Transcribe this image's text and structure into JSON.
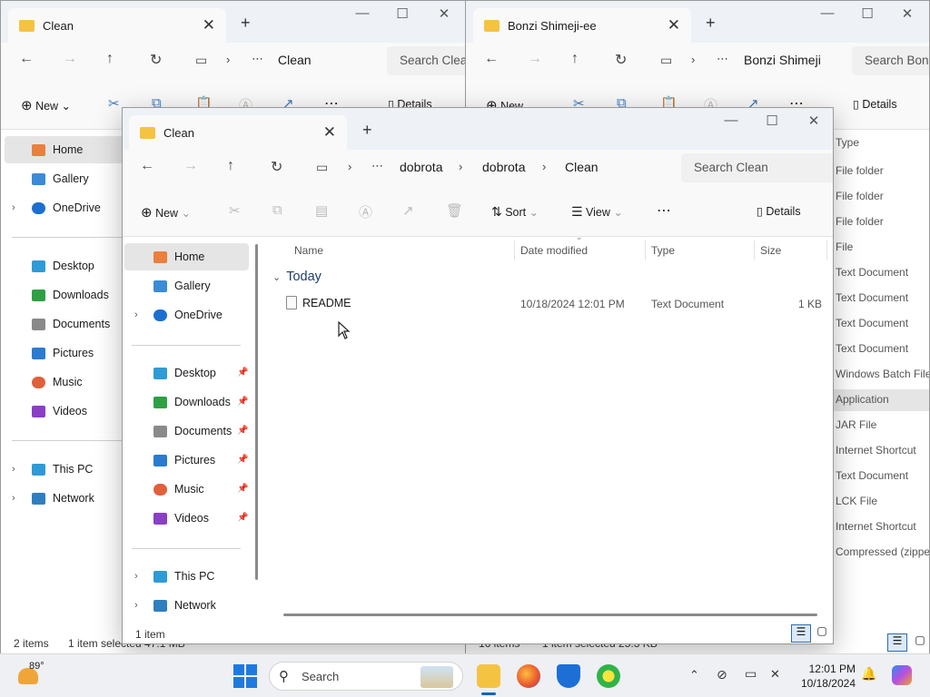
{
  "windows": {
    "left": {
      "tab_title": "Clean",
      "breadcrumb": [
        "Clean"
      ],
      "search_placeholder": "Search Clea",
      "toolbar": {
        "new": "New",
        "details": "Details"
      },
      "sidebar": {
        "home": "Home",
        "gallery": "Gallery",
        "onedrive": "OneDrive",
        "quick": [
          "Desktop",
          "Downloads",
          "Documents",
          "Pictures",
          "Music",
          "Videos"
        ],
        "this_pc": "This PC",
        "network": "Network"
      },
      "status": {
        "items": "2 items",
        "selected": "1 item selected  47.1 MB"
      }
    },
    "right": {
      "tab_title": "Bonzi Shimeji-ee",
      "breadcrumb": [
        "Bonzi Shimeji"
      ],
      "search_placeholder": "Search Bonz",
      "toolbar": {
        "new": "New",
        "details": "Details"
      },
      "type_header": "Type",
      "type_column": [
        "File folder",
        "File folder",
        "File folder",
        "File",
        "Text Document",
        "Text Document",
        "Text Document",
        "Text Document",
        "Windows Batch File",
        "Application",
        "JAR File",
        "Internet Shortcut",
        "Text Document",
        "LCK File",
        "Internet Shortcut",
        "Compressed (zipped"
      ],
      "selected_type": "Application",
      "status": {
        "items": "16 items",
        "selected": "1 item selected  25.3 KB"
      }
    },
    "front": {
      "tab_title": "Clean",
      "breadcrumb": [
        "dobrota",
        "dobrota",
        "Clean"
      ],
      "search_placeholder": "Search Clean",
      "toolbar": {
        "new": "New",
        "sort": "Sort",
        "view": "View",
        "details": "Details"
      },
      "sidebar": {
        "home": "Home",
        "gallery": "Gallery",
        "onedrive": "OneDrive",
        "quick": [
          "Desktop",
          "Downloads",
          "Documents",
          "Pictures",
          "Music",
          "Videos"
        ],
        "this_pc": "This PC",
        "network": "Network"
      },
      "columns": {
        "name": "Name",
        "date": "Date modified",
        "type": "Type",
        "size": "Size"
      },
      "group": "Today",
      "files": [
        {
          "name": "README",
          "date": "10/18/2024 12:01 PM",
          "type": "Text Document",
          "size": "1 KB"
        }
      ],
      "status": {
        "items": "1 item"
      }
    }
  },
  "taskbar": {
    "weather_temp": "89°",
    "search_label": "Search",
    "clock_time": "12:01 PM",
    "clock_date": "10/18/2024"
  },
  "colors": {
    "accent": "#0067c0",
    "folder": "#f5c342",
    "selected_bg": "#e5e5e5"
  }
}
